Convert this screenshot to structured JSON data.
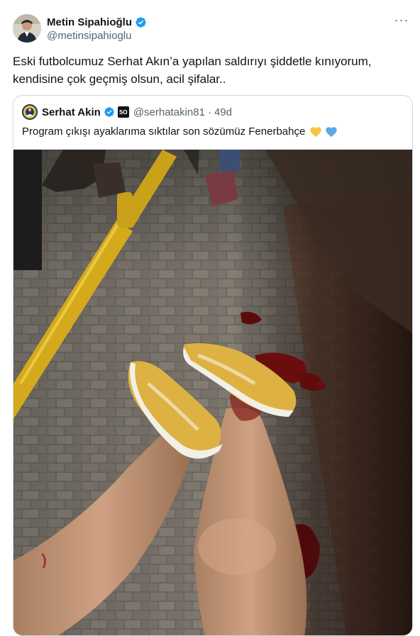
{
  "author": {
    "display_name": "Metin Sipahioğlu",
    "handle": "@metinsipahioglu",
    "avatar_icon": "profile-photo",
    "verified_icon": "verified-badge-icon"
  },
  "menu": {
    "more_label": "···"
  },
  "tweet": {
    "text": "Eski futbolcumuz Serhat Akın’a yapılan saldırıyı şiddetle kınıyorum, kendisine çok geçmiş olsun, acil şifalar.."
  },
  "quoted": {
    "display_name": "Serhat Akin",
    "badge": "SO",
    "handle": "@serhatakin81",
    "separator": "·",
    "time": "49d",
    "text": "Program çıkışı ayaklarıma sıktılar son sözümüz Fenerbahçe",
    "emoji": [
      "yellow-heart",
      "blue-heart"
    ],
    "image_alt": "photo"
  },
  "colors": {
    "verified_blue": "#1d9bf0",
    "text_primary": "#0f1419",
    "text_secondary": "#536471",
    "border": "#cfd9de",
    "heart_yellow": "#f6c443",
    "heart_blue": "#5aa9e6"
  }
}
